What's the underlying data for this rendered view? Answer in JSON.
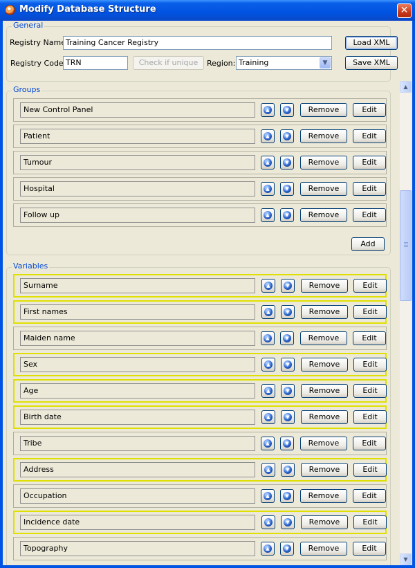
{
  "window": {
    "title": "Modify Database Structure",
    "close": "✕"
  },
  "general": {
    "legend": "General",
    "registry_name_label": "Registry Name:",
    "registry_name_value": "Training Cancer Registry",
    "registry_code_label": "Registry Code:",
    "registry_code_value": "TRN",
    "check_unique": "Check if unique",
    "region_label": "Region:",
    "region_value": "Training",
    "load_xml": "Load XML",
    "save_xml": "Save XML"
  },
  "groups": {
    "legend": "Groups",
    "items": [
      {
        "name": "New Control Panel"
      },
      {
        "name": "Patient"
      },
      {
        "name": "Tumour"
      },
      {
        "name": "Hospital"
      },
      {
        "name": "Follow up"
      }
    ],
    "add_label": "Add"
  },
  "variables": {
    "legend": "Variables",
    "items": [
      {
        "name": "Surname",
        "highlighted": true
      },
      {
        "name": "First names",
        "highlighted": true
      },
      {
        "name": "Maiden name",
        "highlighted": false
      },
      {
        "name": "Sex",
        "highlighted": true
      },
      {
        "name": "Age",
        "highlighted": true
      },
      {
        "name": "Birth date",
        "highlighted": true
      },
      {
        "name": "Tribe",
        "highlighted": false
      },
      {
        "name": "Address",
        "highlighted": true
      },
      {
        "name": "Occupation",
        "highlighted": false
      },
      {
        "name": "Incidence date",
        "highlighted": true
      },
      {
        "name": "Topography",
        "highlighted": false
      }
    ]
  },
  "row_actions": {
    "remove": "Remove",
    "edit": "Edit"
  },
  "icons": {
    "move_up": "move-up-icon",
    "move_down": "move-down-icon"
  },
  "colors": {
    "highlight_border": "#e0e000",
    "legend_text": "#0046d5",
    "titlebar": "#0053e1"
  }
}
